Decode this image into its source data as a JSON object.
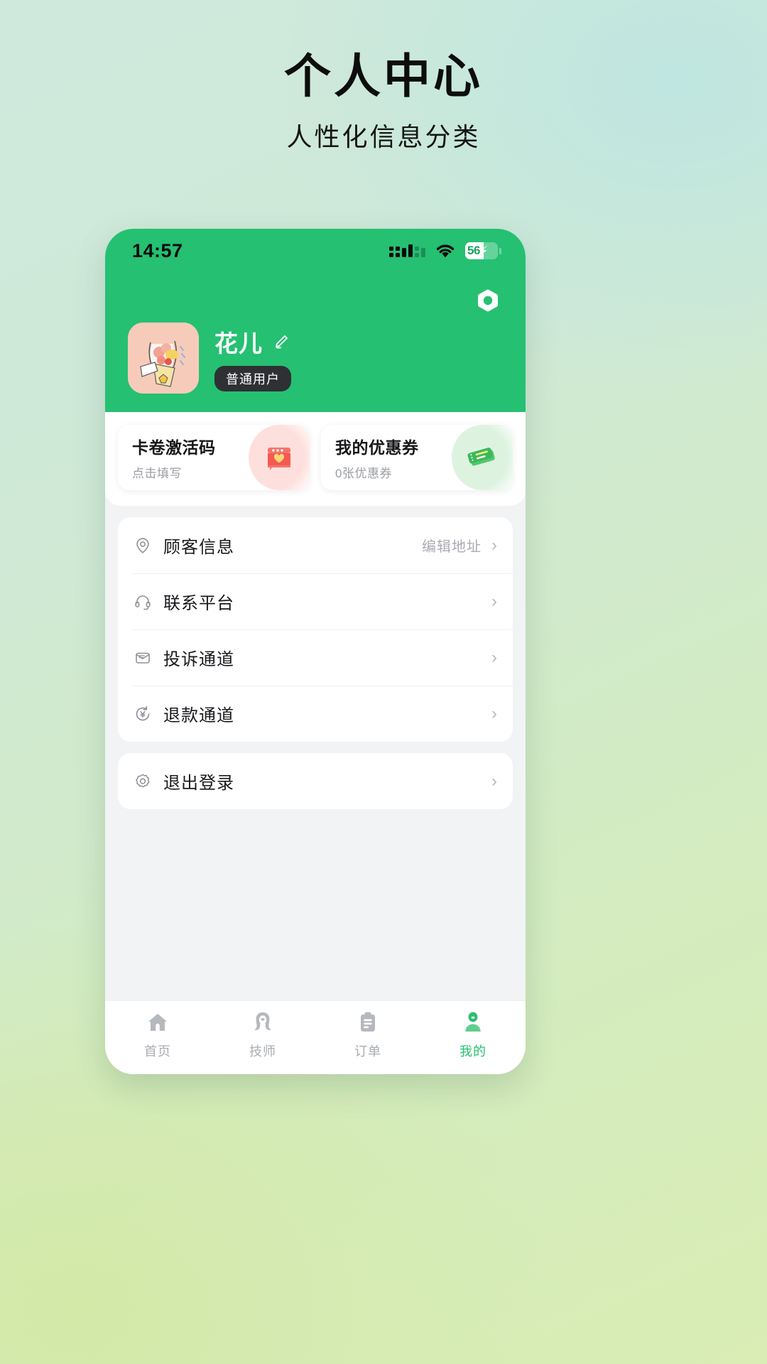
{
  "poster": {
    "title": "个人中心",
    "subtitle": "人性化信息分类"
  },
  "theme": {
    "brand_green": "#25c072",
    "hero_green": "#25c072",
    "page_bg_start": "#cfe9dd",
    "page_bg_end": "#d9edb4",
    "muted_text": "#a9acb2",
    "card_white": "#ffffff"
  },
  "status_bar": {
    "time": "14:57",
    "signal_icon": "signal-bars-icon",
    "wifi_icon": "wifi-icon",
    "battery_percent": "56",
    "battery_charging": true,
    "battery_icon": "battery-charging-icon"
  },
  "hero": {
    "settings_icon": "settings-hex-icon",
    "avatar_icon": "avatar-bouquet-image",
    "username": "花儿",
    "edit_icon": "edit-pencil-icon",
    "role_badge": "普通用户"
  },
  "quick_cards": [
    {
      "title": "卡卷激活码",
      "subtitle": "点击填写",
      "art_icon": "gift-machine-icon",
      "accent": "#fde0dd"
    },
    {
      "title": "我的优惠券",
      "subtitle": "0张优惠券",
      "art_icon": "coupon-tickets-icon",
      "accent": "#ddf3e0"
    }
  ],
  "menu_groups": [
    {
      "items": [
        {
          "label": "顾客信息",
          "icon": "location-pin-icon",
          "hint": "编辑地址",
          "chevron": "›"
        },
        {
          "label": "联系平台",
          "icon": "headset-icon",
          "hint": "",
          "chevron": "›"
        },
        {
          "label": "投诉通道",
          "icon": "envelope-icon",
          "hint": "",
          "chevron": "›"
        },
        {
          "label": "退款通道",
          "icon": "refund-yuan-icon",
          "hint": "",
          "chevron": "›"
        }
      ]
    },
    {
      "items": [
        {
          "label": "退出登录",
          "icon": "gear-icon",
          "hint": "",
          "chevron": "›"
        }
      ]
    }
  ],
  "tabbar": {
    "active_index": 3,
    "tabs": [
      {
        "label": "首页",
        "icon": "home-icon"
      },
      {
        "label": "技师",
        "icon": "technician-icon"
      },
      {
        "label": "订单",
        "icon": "clipboard-order-icon"
      },
      {
        "label": "我的",
        "icon": "person-icon"
      }
    ]
  }
}
